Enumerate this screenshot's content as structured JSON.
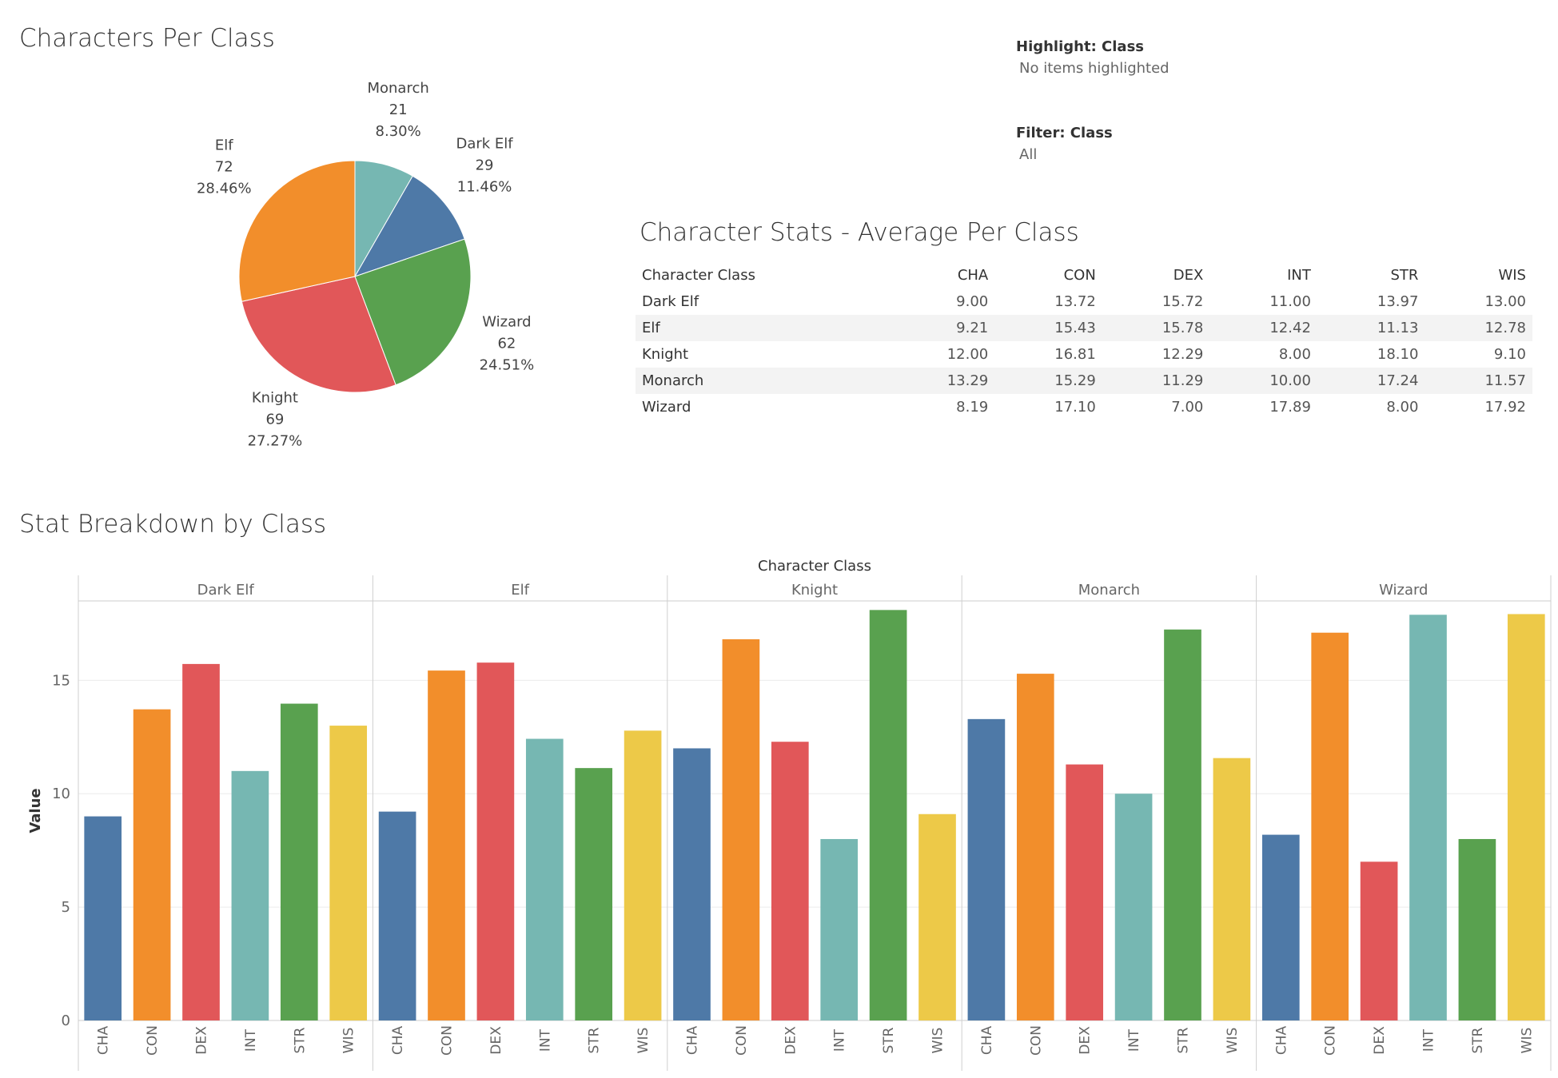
{
  "titles": {
    "pie": "Characters Per Class",
    "table": "Character Stats - Average Per Class",
    "bars": "Stat Breakdown by Class"
  },
  "controls": {
    "highlight_label": "Highlight: Class",
    "highlight_value": "No items highlighted",
    "filter_label": "Filter: Class",
    "filter_value": "All"
  },
  "colors": {
    "CHA": "#4e79a7",
    "CON": "#f28e2b",
    "DEX": "#e15759",
    "INT": "#76b7b2",
    "STR": "#59a14f",
    "WIS": "#edc948",
    "Monarch": "#76b7b2",
    "Dark Elf": "#4e79a7",
    "Wizard": "#59a14f",
    "Knight": "#e15759",
    "Elf": "#f28e2b"
  },
  "table": {
    "headers": [
      "Character Class",
      "CHA",
      "CON",
      "DEX",
      "INT",
      "STR",
      "WIS"
    ],
    "rows": [
      [
        "Dark Elf",
        "9.00",
        "13.72",
        "15.72",
        "11.00",
        "13.97",
        "13.00"
      ],
      [
        "Elf",
        "9.21",
        "15.43",
        "15.78",
        "12.42",
        "11.13",
        "12.78"
      ],
      [
        "Knight",
        "12.00",
        "16.81",
        "12.29",
        "8.00",
        "18.10",
        "9.10"
      ],
      [
        "Monarch",
        "13.29",
        "15.29",
        "11.29",
        "10.00",
        "17.24",
        "11.57"
      ],
      [
        "Wizard",
        "8.19",
        "17.10",
        "7.00",
        "17.89",
        "8.00",
        "17.92"
      ]
    ]
  },
  "chart_data": [
    {
      "type": "pie",
      "title": "Characters Per Class",
      "slices": [
        {
          "label": "Monarch",
          "value": 21,
          "percent": "8.30%"
        },
        {
          "label": "Dark Elf",
          "value": 29,
          "percent": "11.46%"
        },
        {
          "label": "Wizard",
          "value": 62,
          "percent": "24.51%"
        },
        {
          "label": "Knight",
          "value": 69,
          "percent": "27.27%"
        },
        {
          "label": "Elf",
          "value": 72,
          "percent": "28.46%"
        }
      ]
    },
    {
      "type": "bar",
      "title": "Stat Breakdown by Class",
      "column_header": "Character Class",
      "ylabel": "Value",
      "ylim": [
        0,
        18.5
      ],
      "yticks": [
        0,
        5,
        10,
        15
      ],
      "grid": true,
      "groups": [
        "Dark Elf",
        "Elf",
        "Knight",
        "Monarch",
        "Wizard"
      ],
      "categories": [
        "CHA",
        "CON",
        "DEX",
        "INT",
        "STR",
        "WIS"
      ],
      "values": [
        [
          9.0,
          13.72,
          15.72,
          11.0,
          13.97,
          13.0
        ],
        [
          9.21,
          15.43,
          15.78,
          12.42,
          11.13,
          12.78
        ],
        [
          12.0,
          16.81,
          12.29,
          8.0,
          18.1,
          9.1
        ],
        [
          13.29,
          15.29,
          11.29,
          10.0,
          17.24,
          11.57
        ],
        [
          8.19,
          17.1,
          7.0,
          17.89,
          8.0,
          17.92
        ]
      ]
    }
  ]
}
